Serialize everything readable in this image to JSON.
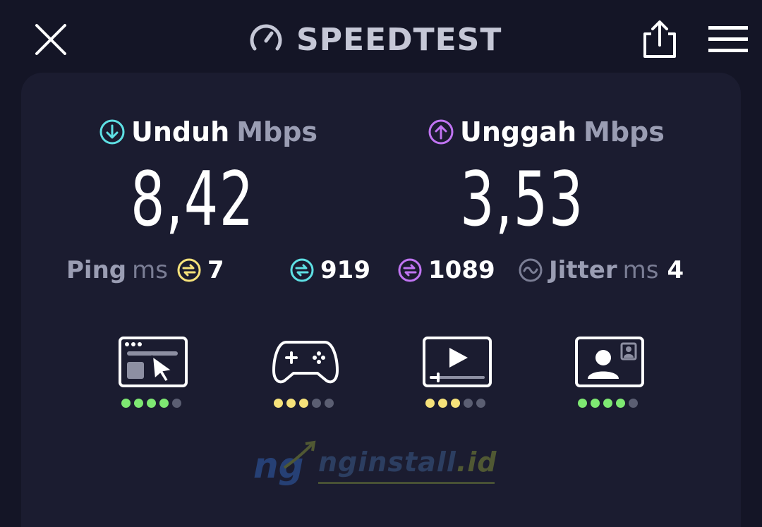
{
  "header": {
    "title": "SPEEDTEST",
    "close_icon": "close-icon",
    "logo_icon": "speedometer-icon",
    "share_icon": "share-icon",
    "menu_icon": "hamburger-menu-icon"
  },
  "download": {
    "label": "Unduh",
    "unit": "Mbps",
    "value": "8,42",
    "icon": "download-arrow-icon",
    "color": "#5ee0e4"
  },
  "upload": {
    "label": "Unggah",
    "unit": "Mbps",
    "value": "3,53",
    "icon": "upload-arrow-icon",
    "color": "#c074f2"
  },
  "stats": {
    "ping": {
      "label": "Ping",
      "unit": "ms",
      "value": "7",
      "color": "#f6e27a"
    },
    "download_latency": {
      "value": "919",
      "color": "#5ee0e4"
    },
    "upload_latency": {
      "value": "1089",
      "color": "#c074f2"
    },
    "jitter": {
      "label": "Jitter",
      "unit": "ms",
      "value": "4",
      "color": "#7b7e95"
    }
  },
  "apps": [
    {
      "name": "web-browsing",
      "icon": "browser-cursor-icon",
      "rating": 4,
      "dot_color": "#7ee872"
    },
    {
      "name": "gaming",
      "icon": "gamepad-icon",
      "rating": 3,
      "dot_color": "#f6e27a"
    },
    {
      "name": "video-streaming",
      "icon": "video-play-icon",
      "rating": 3,
      "dot_color": "#f6e27a"
    },
    {
      "name": "video-chat",
      "icon": "video-call-icon",
      "rating": 4,
      "dot_color": "#7ee872"
    }
  ],
  "watermark": {
    "text": "nginstall",
    "tld": ".id"
  }
}
